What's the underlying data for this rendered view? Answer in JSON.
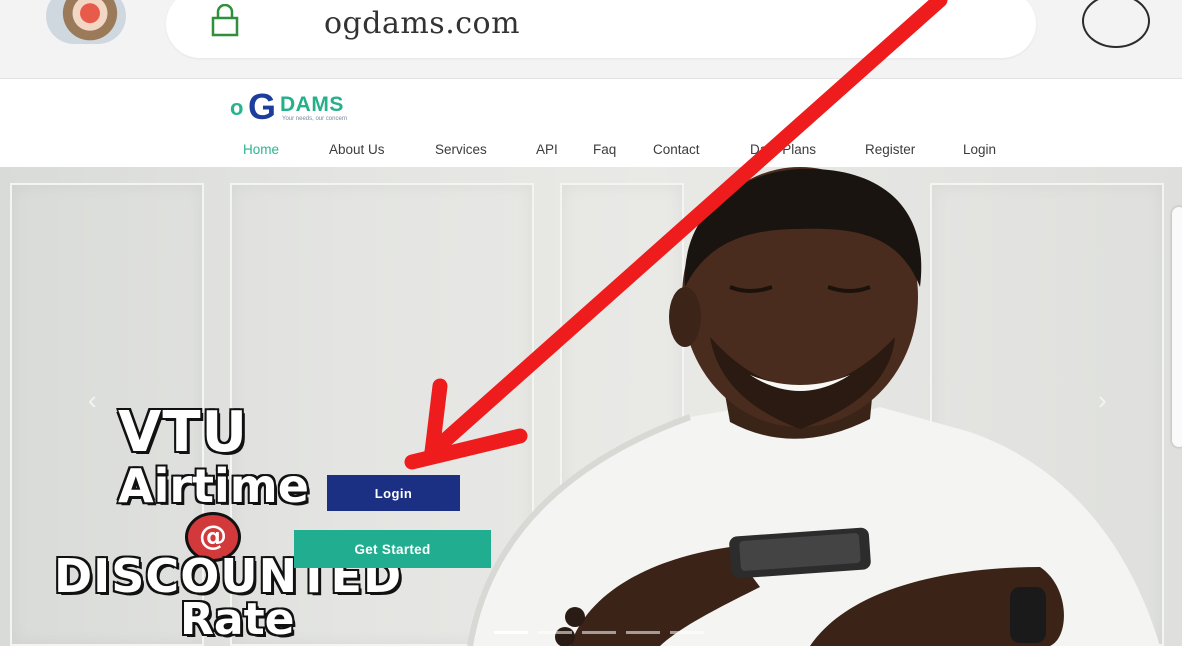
{
  "browser": {
    "url": "ogdams.com"
  },
  "site": {
    "logo": {
      "o": "o",
      "g": "G",
      "name": "DAMS",
      "tagline": "Your needs, our concern"
    },
    "nav": [
      {
        "label": "Home",
        "active": true
      },
      {
        "label": "About Us",
        "active": false
      },
      {
        "label": "Services",
        "active": false
      },
      {
        "label": "API",
        "active": false
      },
      {
        "label": "Faq",
        "active": false
      },
      {
        "label": "Contact",
        "active": false
      },
      {
        "label": "Data Plans",
        "active": false
      },
      {
        "label": "Register",
        "active": false
      },
      {
        "label": "Login",
        "active": false
      }
    ]
  },
  "hero": {
    "promo": {
      "line1": "VTU",
      "line2": "Airtime",
      "line3": "@",
      "line4": "DISCOUNTED",
      "line5": "Rate"
    },
    "login_button": "Login",
    "get_started_button": "Get Started",
    "arrow_left": "‹",
    "arrow_right": "›",
    "slides": 5,
    "active_slide": 0
  },
  "colors": {
    "brand_green": "#21ae90",
    "brand_blue": "#1b2f83",
    "annotation_red": "#ee1c1c"
  }
}
